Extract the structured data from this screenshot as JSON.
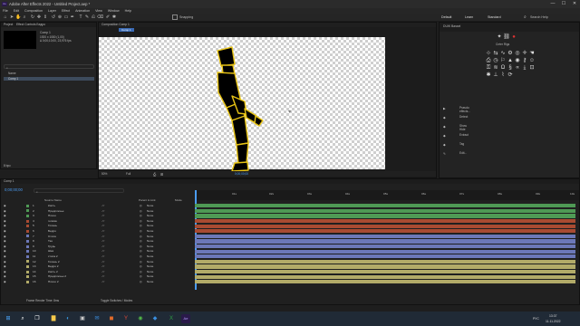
{
  "window": {
    "title": "Adobe After Effects 2022 - Untitled Project.aep *",
    "min": "—",
    "max": "☐",
    "close": "✕"
  },
  "menu": [
    "File",
    "Edit",
    "Composition",
    "Layer",
    "Effect",
    "Animation",
    "View",
    "Window",
    "Help"
  ],
  "toolbar": {
    "snapping": "Snapping",
    "workspaces": [
      "Default",
      "Learn",
      "Standard"
    ],
    "search": "Search Help"
  },
  "project": {
    "tab": "Project",
    "effect_tab": "Effect Controls Бедро",
    "comp_name": "Comp 1",
    "comp_info1": "1920 x 1080 (1,00)",
    "comp_info2": "Δ 0;00;10;00, 23,976 fps",
    "header": "Name",
    "item": "Comp 1",
    "bpc": "8 bpc"
  },
  "composition": {
    "tab": "Composition",
    "comp": "Comp 1",
    "breadcrumb": "Comp 1",
    "zoom": "50%",
    "quality": "Full",
    "timecode": "0;00;00;00"
  },
  "effects_panel": {
    "title": "DUIK Bassel",
    "section": "Créer Rigs",
    "items": [
      {
        "icon": "▶",
        "label": "Pseudo effects..."
      },
      {
        "icon": "◆",
        "label": "Detect"
      },
      {
        "icon": "◆",
        "label": "Show Hide"
      },
      {
        "icon": "◆",
        "label": "Extract"
      },
      {
        "icon": "◆",
        "label": "Tag"
      },
      {
        "icon": "✎",
        "label": "Edit..."
      }
    ]
  },
  "timeline": {
    "tab": "Comp 1",
    "timecode": "0;00;00;00",
    "col_source": "Source Name",
    "col_parent": "Parent & Link",
    "col_mode": "Mode",
    "ruler": [
      "0s",
      "01s",
      "02s",
      "03s",
      "04s",
      "05s",
      "06s",
      "07s",
      "08s",
      "09s",
      "10s"
    ],
    "layers": [
      {
        "num": "1",
        "name": "Кисть",
        "parent": "None",
        "color": "#4f9a55"
      },
      {
        "num": "2",
        "name": "Предплечье",
        "parent": "None",
        "color": "#4f9a55"
      },
      {
        "num": "3",
        "name": "Плечо",
        "parent": "None",
        "color": "#4f9a55"
      },
      {
        "num": "4",
        "name": "голова",
        "parent": "None",
        "color": "#a84b32"
      },
      {
        "num": "5",
        "name": "Голень",
        "parent": "None",
        "color": "#a84b32"
      },
      {
        "num": "6",
        "name": "Бедро",
        "parent": "None",
        "color": "#a84b32"
      },
      {
        "num": "7",
        "name": "Стопа",
        "parent": "None",
        "color": "#6c78b8"
      },
      {
        "num": "8",
        "name": "Таз",
        "parent": "None",
        "color": "#6c78b8"
      },
      {
        "num": "9",
        "name": "Грудь",
        "parent": "None",
        "color": "#6c78b8"
      },
      {
        "num": "10",
        "name": "Шея",
        "parent": "None",
        "color": "#6c78b8"
      },
      {
        "num": "11",
        "name": "стопа 2",
        "parent": "None",
        "color": "#6c78b8"
      },
      {
        "num": "12",
        "name": "Голень 2",
        "parent": "None",
        "color": "#b2ab68"
      },
      {
        "num": "13",
        "name": "Бедро 2",
        "parent": "None",
        "color": "#b2ab68"
      },
      {
        "num": "14",
        "name": "Кисть 2",
        "parent": "None",
        "color": "#b2ab68"
      },
      {
        "num": "15",
        "name": "Предплечье 2",
        "parent": "None",
        "color": "#b2ab68"
      },
      {
        "num": "16",
        "name": "Плечо 2",
        "parent": "None",
        "color": "#b2ab68"
      }
    ],
    "footer_left": "Frame Render Time: 8ms",
    "footer_mid": "Toggle Switches / Modes"
  },
  "taskbar": {
    "lang": "РУС",
    "time": "13:37",
    "date": "11.11.2022"
  }
}
